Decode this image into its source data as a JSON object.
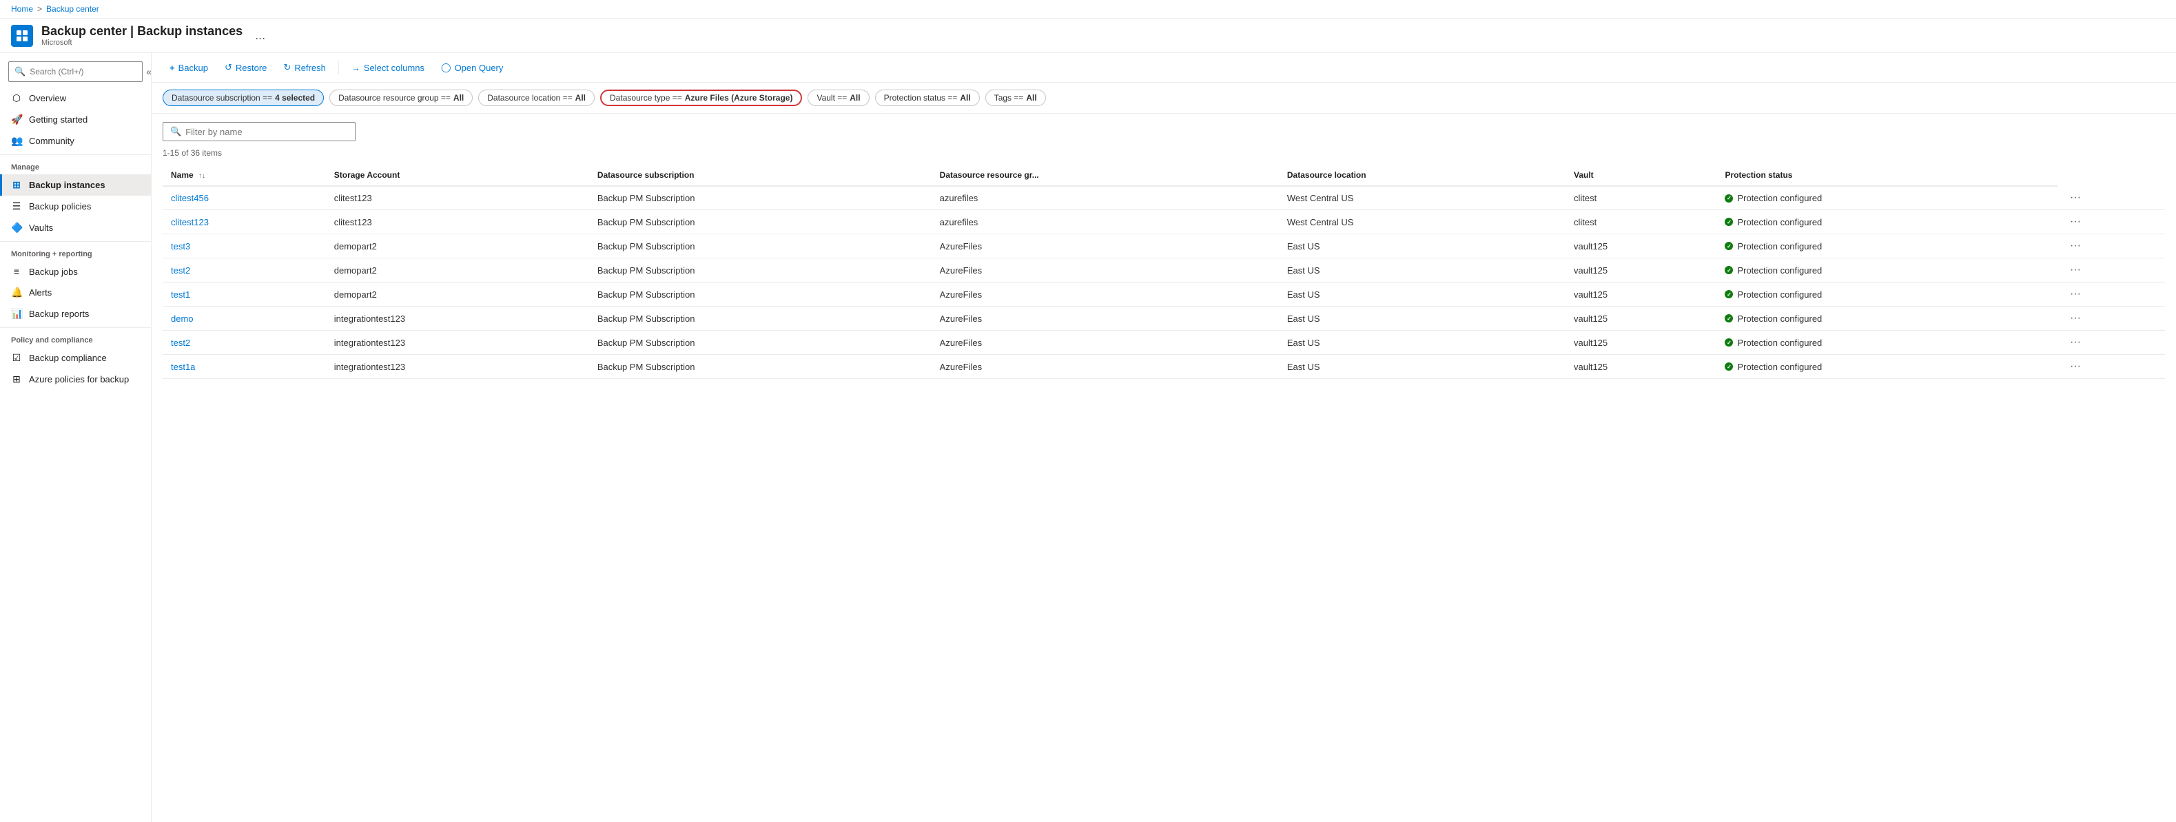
{
  "breadcrumb": {
    "home": "Home",
    "separator": ">",
    "current": "Backup center"
  },
  "header": {
    "title": "Backup center | Backup instances",
    "subtitle": "Microsoft",
    "ellipsis": "..."
  },
  "sidebar": {
    "search_placeholder": "Search (Ctrl+/)",
    "collapse_icon": "«",
    "items_top": [
      {
        "id": "overview",
        "label": "Overview",
        "icon": "⬡"
      },
      {
        "id": "getting-started",
        "label": "Getting started",
        "icon": "🚀"
      },
      {
        "id": "community",
        "label": "Community",
        "icon": "👥"
      }
    ],
    "section_manage": "Manage",
    "items_manage": [
      {
        "id": "backup-instances",
        "label": "Backup instances",
        "icon": "⊞",
        "active": true
      },
      {
        "id": "backup-policies",
        "label": "Backup policies",
        "icon": "☰"
      },
      {
        "id": "vaults",
        "label": "Vaults",
        "icon": "🔷"
      }
    ],
    "section_monitoring": "Monitoring + reporting",
    "items_monitoring": [
      {
        "id": "backup-jobs",
        "label": "Backup jobs",
        "icon": "≡"
      },
      {
        "id": "alerts",
        "label": "Alerts",
        "icon": "🔔"
      },
      {
        "id": "backup-reports",
        "label": "Backup reports",
        "icon": "📊"
      }
    ],
    "section_policy": "Policy and compliance",
    "items_policy": [
      {
        "id": "backup-compliance",
        "label": "Backup compliance",
        "icon": "☑"
      },
      {
        "id": "azure-policies",
        "label": "Azure policies for backup",
        "icon": "⊞"
      }
    ]
  },
  "toolbar": {
    "buttons": [
      {
        "id": "backup",
        "label": "Backup",
        "icon": "+"
      },
      {
        "id": "restore",
        "label": "Restore",
        "icon": "↺"
      },
      {
        "id": "refresh",
        "label": "Refresh",
        "icon": "↻"
      },
      {
        "id": "select-columns",
        "label": "Select columns",
        "icon": "→"
      },
      {
        "id": "open-query",
        "label": "Open Query",
        "icon": "◯"
      }
    ]
  },
  "filters": [
    {
      "id": "datasource-subscription",
      "label": "Datasource subscription == ",
      "value": "4 selected",
      "active": true,
      "highlighted": false
    },
    {
      "id": "datasource-resource-group",
      "label": "Datasource resource group == ",
      "value": "All",
      "active": false,
      "highlighted": false
    },
    {
      "id": "datasource-location",
      "label": "Datasource location == ",
      "value": "All",
      "active": false,
      "highlighted": false
    },
    {
      "id": "datasource-type",
      "label": "Datasource type == ",
      "value": "Azure Files (Azure Storage)",
      "active": false,
      "highlighted": true
    },
    {
      "id": "vault",
      "label": "Vault == ",
      "value": "All",
      "active": false,
      "highlighted": false
    },
    {
      "id": "protection-status",
      "label": "Protection status == ",
      "value": "All",
      "active": false,
      "highlighted": false
    },
    {
      "id": "tags",
      "label": "Tags == ",
      "value": "All",
      "active": false,
      "highlighted": false
    }
  ],
  "content": {
    "filter_placeholder": "Filter by name",
    "item_count": "1-15 of 36 items",
    "columns": [
      {
        "id": "name",
        "label": "Name",
        "sortable": true
      },
      {
        "id": "storage-account",
        "label": "Storage Account"
      },
      {
        "id": "datasource-subscription",
        "label": "Datasource subscription"
      },
      {
        "id": "datasource-resource-group",
        "label": "Datasource resource gr..."
      },
      {
        "id": "datasource-location",
        "label": "Datasource location"
      },
      {
        "id": "vault",
        "label": "Vault"
      },
      {
        "id": "protection-status",
        "label": "Protection status"
      }
    ],
    "rows": [
      {
        "name": "clitest456",
        "storage_account": "clitest123",
        "subscription": "Backup PM Subscription",
        "resource_group": "azurefiles",
        "location": "West Central US",
        "vault": "clitest",
        "status": "Protection configured"
      },
      {
        "name": "clitest123",
        "storage_account": "clitest123",
        "subscription": "Backup PM Subscription",
        "resource_group": "azurefiles",
        "location": "West Central US",
        "vault": "clitest",
        "status": "Protection configured"
      },
      {
        "name": "test3",
        "storage_account": "demopart2",
        "subscription": "Backup PM Subscription",
        "resource_group": "AzureFiles",
        "location": "East US",
        "vault": "vault125",
        "status": "Protection configured"
      },
      {
        "name": "test2",
        "storage_account": "demopart2",
        "subscription": "Backup PM Subscription",
        "resource_group": "AzureFiles",
        "location": "East US",
        "vault": "vault125",
        "status": "Protection configured"
      },
      {
        "name": "test1",
        "storage_account": "demopart2",
        "subscription": "Backup PM Subscription",
        "resource_group": "AzureFiles",
        "location": "East US",
        "vault": "vault125",
        "status": "Protection configured"
      },
      {
        "name": "demo",
        "storage_account": "integrationtest123",
        "subscription": "Backup PM Subscription",
        "resource_group": "AzureFiles",
        "location": "East US",
        "vault": "vault125",
        "status": "Protection configured"
      },
      {
        "name": "test2",
        "storage_account": "integrationtest123",
        "subscription": "Backup PM Subscription",
        "resource_group": "AzureFiles",
        "location": "East US",
        "vault": "vault125",
        "status": "Protection configured"
      },
      {
        "name": "test1a",
        "storage_account": "integrationtest123",
        "subscription": "Backup PM Subscription",
        "resource_group": "AzureFiles",
        "location": "East US",
        "vault": "vault125",
        "status": "Protection configured"
      }
    ]
  },
  "colors": {
    "accent": "#0078d4",
    "success": "#107c10",
    "danger": "#d13438",
    "border": "#edebe9",
    "text_secondary": "#605e5c"
  }
}
